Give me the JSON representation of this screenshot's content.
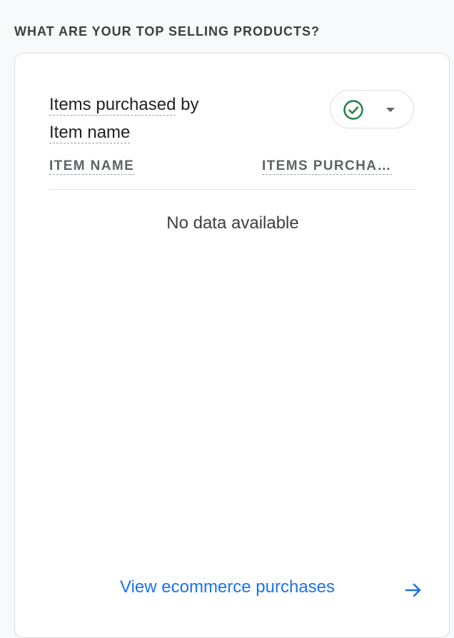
{
  "section": {
    "title": "WHAT ARE YOUR TOP SELLING PRODUCTS?"
  },
  "card": {
    "title_metric": "Items purchased",
    "title_by": " by",
    "title_dimension": "Item name",
    "status_icon": "check-circle-icon",
    "dropdown_icon": "dropdown-arrow-icon",
    "status_color": "#188038",
    "columns": {
      "item_name": "ITEM NAME",
      "items_purchased": "ITEMS PURCHA…"
    },
    "empty_message": "No data available",
    "footer_link": "View ecommerce purchases",
    "footer_icon": "arrow-right-icon",
    "accent_color": "#1a73e8"
  }
}
